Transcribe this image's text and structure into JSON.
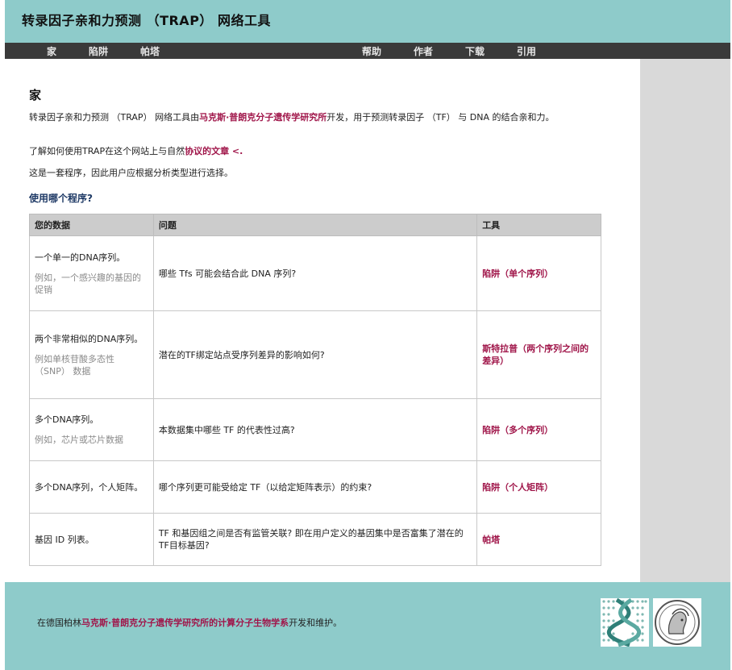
{
  "header": {
    "title": "转录因子亲和力预测 （TRAP） 网络工具"
  },
  "nav": {
    "left": [
      "家",
      "陷阱",
      "帕塔"
    ],
    "right": [
      "帮助",
      "作者",
      "下载",
      "引用"
    ]
  },
  "main": {
    "heading": "家",
    "intro_before": "转录因子亲和力预测 （TRAP） 网络工具由",
    "intro_link": "马克斯·普朗克分子遗传学研究所",
    "intro_after": "开发，用于预测转录因子 （TF） 与 DNA 的结合亲和力。",
    "learn_before": "了解如何使用TRAP在这个网站上与自然",
    "learn_link": "协议的文章 <.",
    "suite_text": "这是一套程序，因此用户应根据分析类型进行选择。",
    "which_program": "使用哪个程序?",
    "table": {
      "headers": [
        "您的数据",
        "问题",
        "工具"
      ],
      "rows": [
        {
          "data": "一个单一的DNA序列。",
          "example": "例如，一个感兴趣的基因的促销",
          "question": "哪些 Tfs 可能会结合此 DNA 序列?",
          "tool": "陷阱（单个序列）"
        },
        {
          "data": "两个非常相似的DNA序列。",
          "example": "例如单核苷酸多态性 （SNP） 数据",
          "question": "潜在的TF绑定站点受序列差异的影响如何?",
          "tool": "斯特拉普（两个序列之间的差异）"
        },
        {
          "data": "多个DNA序列。",
          "example": "例如，芯片或芯片数据",
          "question": "本数据集中哪些 TF 的代表性过高?",
          "tool": "陷阱（多个序列）"
        },
        {
          "data": "多个DNA序列，个人矩阵。",
          "example": "",
          "question": "哪个序列更可能受给定 TF（以给定矩阵表示）的约束?",
          "tool": "陷阱（个人矩阵）"
        },
        {
          "data": "基因 ID 列表。",
          "example": "",
          "question": "TF 和基因组之间是否有监管关联? 即在用户定义的基因集中是否富集了潜在的TF目标基因?",
          "tool": "帕塔"
        }
      ]
    }
  },
  "footer": {
    "text_before": "在德国柏林",
    "link": "马克斯·普朗克分子遗传学研究所的计算分子生物学系",
    "text_after": "开发和维护。"
  },
  "colors": {
    "teal": "#8ecbca",
    "nav": "#3a3a3a",
    "link": "#a0164a",
    "sidebar": "#d9d9d9"
  }
}
